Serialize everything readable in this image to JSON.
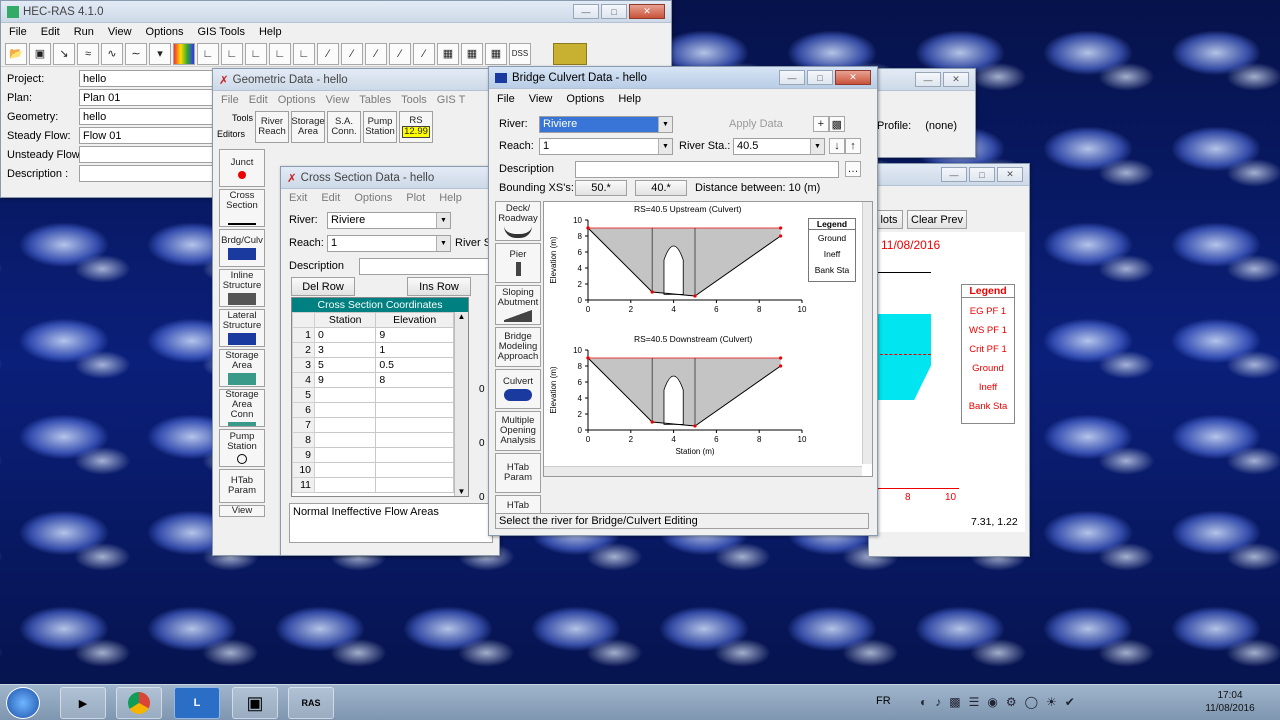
{
  "main": {
    "title": "HEC-RAS 4.1.0",
    "menu": [
      "File",
      "Edit",
      "Run",
      "View",
      "Options",
      "GIS Tools",
      "Help"
    ],
    "fields": [
      {
        "label": "Project:",
        "value": "hello"
      },
      {
        "label": "Plan:",
        "value": "Plan 01"
      },
      {
        "label": "Geometry:",
        "value": "hello"
      },
      {
        "label": "Steady Flow:",
        "value": "Flow 01"
      },
      {
        "label": "Unsteady Flow:",
        "value": ""
      },
      {
        "label": "Description :",
        "value": ""
      }
    ]
  },
  "geometry": {
    "title": "Geometric Data - hello",
    "menu": [
      "File",
      "Edit",
      "Options",
      "View",
      "Tables",
      "Tools",
      "GIS T"
    ],
    "tools_label": "Tools",
    "editors_label": "Editors",
    "toolbar": [
      "River Reach",
      "Storage Area",
      "S.A. Conn.",
      "Pump Station",
      "RS"
    ],
    "rs_value": "12.99",
    "editors": [
      "Junct",
      "Cross Section",
      "Brdg/Culv",
      "Inline Structure",
      "Lateral Structure",
      "Storage Area",
      "Storage Area Conn",
      "Pump Station",
      "HTab Param",
      "View"
    ]
  },
  "xs": {
    "title": "Cross Section Data - hello",
    "menu": [
      "Exit",
      "Edit",
      "Options",
      "Plot",
      "Help"
    ],
    "river_label": "River:",
    "river_value": "Riviere",
    "reach_label": "Reach:",
    "reach_value": "1",
    "river_sta_label": "River S",
    "description_label": "Description",
    "del_row": "Del Row",
    "ins_row": "Ins Row",
    "table_title": "Cross Section Coordinates",
    "col_station": "Station",
    "col_elevation": "Elevation",
    "rows": [
      {
        "n": "1",
        "sta": "0",
        "elev": "9"
      },
      {
        "n": "2",
        "sta": "3",
        "elev": "1"
      },
      {
        "n": "3",
        "sta": "5",
        "elev": "0.5"
      },
      {
        "n": "4",
        "sta": "9",
        "elev": "8"
      },
      {
        "n": "5",
        "sta": "",
        "elev": ""
      },
      {
        "n": "6",
        "sta": "",
        "elev": ""
      },
      {
        "n": "7",
        "sta": "",
        "elev": ""
      },
      {
        "n": "8",
        "sta": "",
        "elev": ""
      },
      {
        "n": "9",
        "sta": "",
        "elev": ""
      },
      {
        "n": "10",
        "sta": "",
        "elev": ""
      },
      {
        "n": "11",
        "sta": "",
        "elev": ""
      }
    ],
    "status": "Normal Ineffective Flow Areas",
    "side_vals": [
      "0",
      "0",
      "0"
    ]
  },
  "profile": {
    "profile_label": "Profile:",
    "profile_value": "(none)",
    "plots_btn": "lots",
    "clear_prev": "Clear Prev",
    "date": "11/08/2016",
    "legend_title": "Legend",
    "legend": [
      "EG PF 1",
      "WS PF 1",
      "Crit PF 1",
      "Ground",
      "Ineff",
      "Bank Sta"
    ],
    "axis_8": "8",
    "axis_10": "10",
    "coords": "7.31, 1.22"
  },
  "bridge": {
    "title": "Bridge Culvert Data - hello",
    "menu": [
      "File",
      "View",
      "Options",
      "Help"
    ],
    "river_label": "River:",
    "river_value": "Riviere",
    "apply_label": "Apply Data",
    "reach_label": "Reach:",
    "reach_value": "1",
    "river_sta_label": "River Sta.:",
    "river_sta_value": "40.5",
    "description_label": "Description",
    "bounding_label": "Bounding XS's:",
    "bounding_1": "50.*",
    "bounding_2": "40.*",
    "distance_label": "Distance between: 10 (m)",
    "tools": [
      "Deck/ Roadway",
      "Pier",
      "Sloping Abutment",
      "Bridge Modeling Approach",
      "Culvert",
      "Multiple Opening Analysis",
      "HTab Param",
      "HTab"
    ],
    "status": "Select the river for Bridge/Culvert Editing",
    "plot_upstream_title": "RS=40.5   Upstream  (Culvert)",
    "plot_downstream_title": "RS=40.5   Downstream  (Culvert)",
    "ylabel": "Elevation (m)",
    "xlabel": "Station (m)",
    "legend_title": "Legend",
    "legend": [
      "Ground",
      "Ineff",
      "Bank Sta"
    ],
    "yticks": [
      "10",
      "8",
      "6",
      "4",
      "2",
      "0"
    ],
    "xticks": [
      "0",
      "2",
      "4",
      "6",
      "8",
      "10"
    ]
  },
  "taskbar": {
    "time": "17:04",
    "date": "11/08/2016",
    "lang": "FR"
  },
  "chart_data": [
    {
      "type": "line",
      "title": "RS=40.5   Upstream  (Culvert)",
      "xlabel": "Station (m)",
      "ylabel": "Elevation (m)",
      "xlim": [
        0,
        10
      ],
      "ylim": [
        0,
        10
      ],
      "series": [
        {
          "name": "Ground",
          "x": [
            0,
            3,
            5,
            9
          ],
          "y": [
            9,
            1,
            0.5,
            8
          ]
        }
      ]
    },
    {
      "type": "line",
      "title": "RS=40.5   Downstream  (Culvert)",
      "xlabel": "Station (m)",
      "ylabel": "Elevation (m)",
      "xlim": [
        0,
        10
      ],
      "ylim": [
        0,
        10
      ],
      "series": [
        {
          "name": "Ground",
          "x": [
            0,
            3,
            5,
            9
          ],
          "y": [
            9,
            1,
            0.5,
            8
          ]
        }
      ]
    }
  ],
  "colors": {
    "selection": "#3875d7",
    "table_header": "#008080",
    "cyan_fill": "#00e5f0",
    "legend_red": "#e00000"
  }
}
